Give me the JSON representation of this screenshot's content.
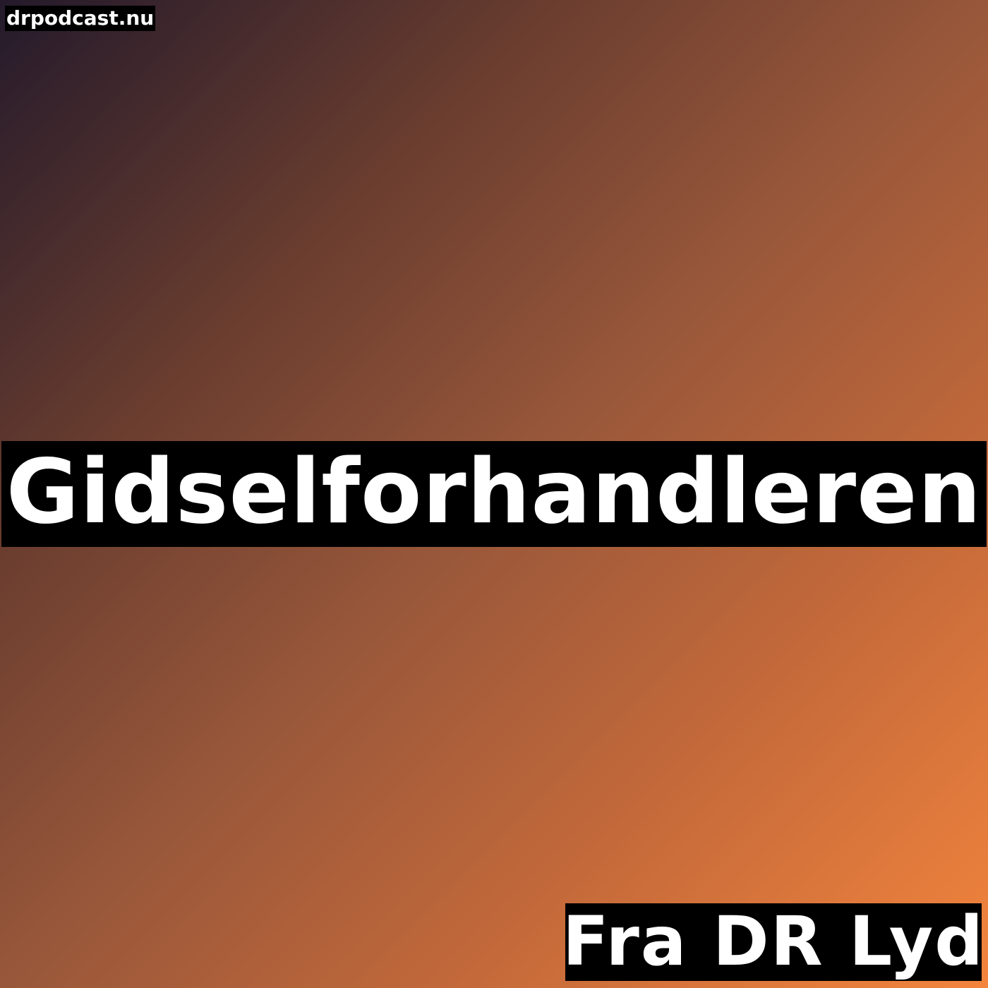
{
  "site_tag": "drpodcast.nu",
  "title": "Gidselforhandleren",
  "source": "Fra DR Lyd",
  "colors": {
    "gradient_start": "#241a2b",
    "gradient_end": "#f3843d",
    "box_background": "#000000",
    "text": "#ffffff"
  }
}
